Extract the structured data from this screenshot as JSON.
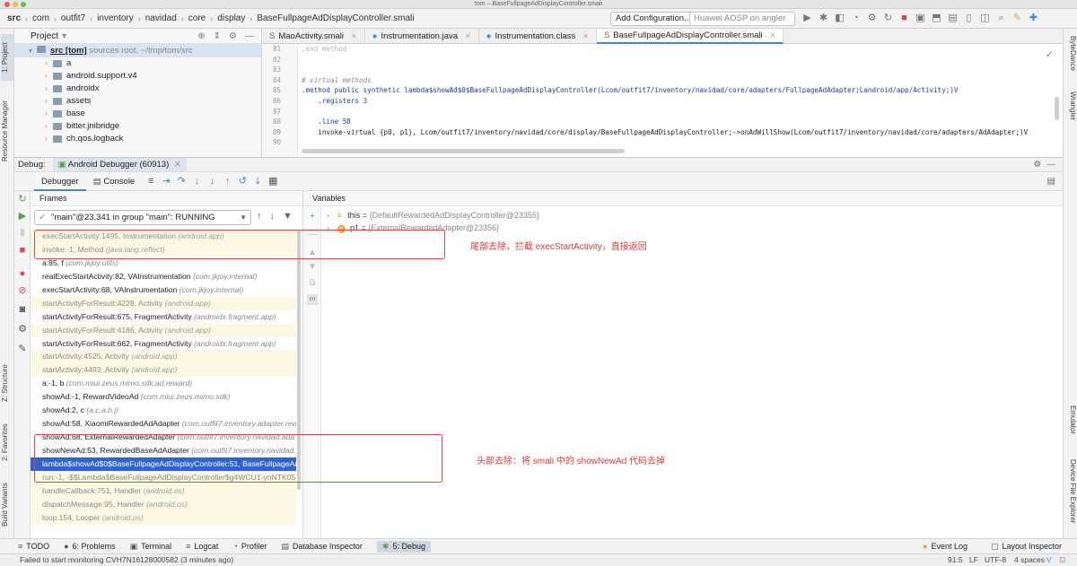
{
  "window": {
    "title": "tom – BaseFullpageAdDisplayController.smali"
  },
  "nav": {
    "crumbs": [
      "src",
      "com",
      "outfit7",
      "inventory",
      "navidad",
      "core",
      "display",
      "BaseFullpageAdDisplayController.smali"
    ],
    "config_button": "Add Configuration...",
    "device": "Huawei AOSP on angler"
  },
  "stripes": {
    "left": [
      "1: Project",
      "Resource Manager",
      "Z: Structure",
      "2: Favorites",
      "Build Variants"
    ],
    "right": [
      "ByteDance",
      "Wrangler",
      "Emulator",
      "Device File Explorer"
    ]
  },
  "project": {
    "header": "Project",
    "root_name": "src [tom]",
    "root_path": "sources root, ~/tmp/tom/src",
    "items": [
      "a",
      "android.support.v4",
      "androidx",
      "assets",
      "base",
      "bitter.jnibridge",
      "ch.qos.logback"
    ]
  },
  "editor": {
    "tabs": [
      "MaoActivity.smali",
      "Instrumentation.java",
      "Instrumentation.class",
      "BaseFullpageAdDisplayController.smali"
    ],
    "line_numbers": [
      "81",
      "82",
      "83",
      "84",
      "85",
      "86",
      "87",
      "88",
      "89",
      "90"
    ],
    "code_lines": [
      ".end method",
      "",
      "",
      "# virtual methods",
      ".method public synthetic lambda$showAd$0$BaseFullpageAdDisplayController(Lcom/outfit7/inventory/navidad/core/adapters/FullpageAdAdapter;Landroid/app/Activity;)V",
      "    .registers 3",
      "",
      "    .line 58",
      "    invoke-virtual {p0, p1}, Lcom/outfit7/inventory/navidad/core/display/BaseFullpageAdDisplayController;->onAdWillShow(Lcom/outfit7/inventory/navidad/core/adapters/AdAdapter;)V",
      ""
    ]
  },
  "debug": {
    "title": "Debug:",
    "session": "Android Debugger (60913)",
    "subtabs": [
      "Debugger",
      "Console"
    ]
  },
  "frames": {
    "header": "Frames",
    "thread": "\"main\"@23,341 in group \"main\": RUNNING",
    "items": [
      {
        "method": "execStartActivity:1495, Instrumentation",
        "pkg": "(android.app)",
        "kind": "lib"
      },
      {
        "method": "invoke:-1, Method",
        "pkg": "(java.lang.reflect)",
        "kind": "lib"
      },
      {
        "method": "a:85, f",
        "pkg": "(com.jkjoy.utils)",
        "kind": "user"
      },
      {
        "method": "realExecStartActivity:82, VAInstrumentation",
        "pkg": "(com.jkjoy.internal)",
        "kind": "user"
      },
      {
        "method": "execStartActivity:68, VAInstrumentation",
        "pkg": "(com.jkjoy.internal)",
        "kind": "user"
      },
      {
        "method": "startActivityForResult:4228, Activity",
        "pkg": "(android.app)",
        "kind": "lib"
      },
      {
        "method": "startActivityForResult:675, FragmentActivity",
        "pkg": "(androidx.fragment.app)",
        "kind": "user"
      },
      {
        "method": "startActivityForResult:4186, Activity",
        "pkg": "(android.app)",
        "kind": "lib"
      },
      {
        "method": "startActivityForResult:662, FragmentActivity",
        "pkg": "(androidx.fragment.app)",
        "kind": "user"
      },
      {
        "method": "startActivity:4525, Activity",
        "pkg": "(android.app)",
        "kind": "lib"
      },
      {
        "method": "startActivity:4493, Activity",
        "pkg": "(android.app)",
        "kind": "lib"
      },
      {
        "method": "a:-1, b",
        "pkg": "(com.miui.zeus.mimo.sdk.ad.reward)",
        "kind": "user"
      },
      {
        "method": "showAd:-1, RewardVideoAd",
        "pkg": "(com.miui.zeus.mimo.sdk)",
        "kind": "user"
      },
      {
        "method": "showAd:2, c",
        "pkg": "(a.c.a.b.j)",
        "kind": "user"
      },
      {
        "method": "showAd:58, XiaomiRewardedAdAdapter",
        "pkg": "(com.outfit7.inventory.adapter.rewar",
        "kind": "user"
      },
      {
        "method": "showAd:68, ExternalRewardedAdapter",
        "pkg": "(com.outfit7.inventory.navidad.ada",
        "kind": "user"
      },
      {
        "method": "showNewAd:53, RewardedBaseAdAdapter",
        "pkg": "(com.outfit7.inventory.navidad.",
        "kind": "user"
      },
      {
        "method": "lambda$showAd$0$BaseFullpageAdDisplayController:51, BaseFullpageAd",
        "pkg": "",
        "kind": "sel"
      },
      {
        "method": "run:-1, -$$Lambda$BaseFullpageAdDisplayController$g4WCU1-ynNTK05I",
        "pkg": "",
        "kind": "lib"
      },
      {
        "method": "handleCallback:751, Handler",
        "pkg": "(android.os)",
        "kind": "lib"
      },
      {
        "method": "dispatchMessage:95, Handler",
        "pkg": "(android.os)",
        "kind": "lib"
      },
      {
        "method": "loop:154, Looper",
        "pkg": "(android.os)",
        "kind": "lib"
      }
    ]
  },
  "variables": {
    "header": "Variables",
    "items": [
      {
        "name": "this",
        "op": " = ",
        "value": "{DefaultRewardedAdDisplayController@23355}"
      },
      {
        "name": "p1",
        "op": " = ",
        "value": "{ExternalRewardedAdapter@23356}"
      }
    ]
  },
  "annotations": [
    "尾部去除，拦截 execStartActivity，直接返回",
    "头部去除：将 smali 中的 showNewAd 代码去掉"
  ],
  "bottom_tabs": [
    "TODO",
    "6: Problems",
    "Terminal",
    "Logcat",
    "Profiler",
    "Database Inspector",
    "5: Debug",
    "Event Log",
    "Layout Inspector"
  ],
  "status": {
    "message": "Failed to start monitoring CVH7N16128000582 (3 minutes ago)",
    "position": "91:5",
    "line_sep": "LF",
    "encoding": "UTF-8",
    "indent": "4 spaces"
  }
}
